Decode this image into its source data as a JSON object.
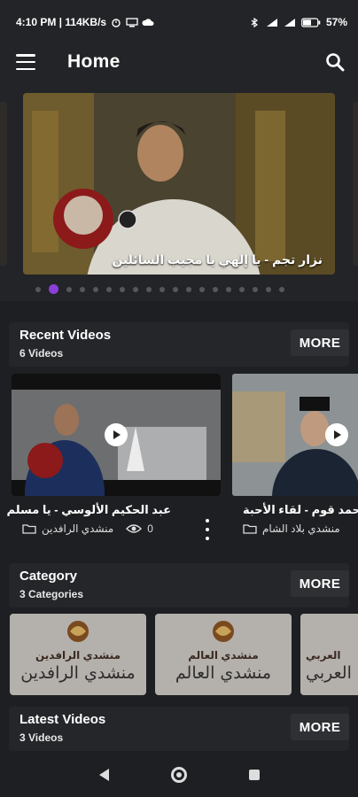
{
  "status_bar": {
    "time_speed": "4:10 PM | 114KB/s",
    "battery": "57%"
  },
  "app_bar": {
    "title": "Home",
    "menu_icon": "hamburger-menu-icon",
    "search_icon": "search-icon"
  },
  "slider": {
    "caption": "نزار تجم - يا إلهي يا مجيب السائلين",
    "total_slides": 19,
    "active_index": 1
  },
  "recent_videos": {
    "title": "Recent Videos",
    "subtitle": "6 Videos",
    "more_label": "MORE",
    "items": [
      {
        "title": "عبد الحكيم الألوسي - يا مسلم",
        "category": "منشدي الرافدين",
        "views": "0"
      },
      {
        "title": "محمد قوم - لقاء الأحبة",
        "category": "منشدي بلاد الشام"
      }
    ]
  },
  "category": {
    "title": "Category",
    "subtitle": "3 Categories",
    "more_label": "MORE",
    "items": [
      {
        "small": "منشدي الرافدين",
        "large": "منشدي الرافدين"
      },
      {
        "small": "منشدي العالم",
        "large": "منشدي العالم"
      },
      {
        "small": "العربي",
        "large": "العربي"
      }
    ]
  },
  "latest_videos": {
    "title": "Latest Videos",
    "subtitle": "3 Videos",
    "more_label": "MORE"
  },
  "colors": {
    "accent": "#8b3fd9",
    "background": "#1e1f22",
    "surface": "#232427"
  }
}
